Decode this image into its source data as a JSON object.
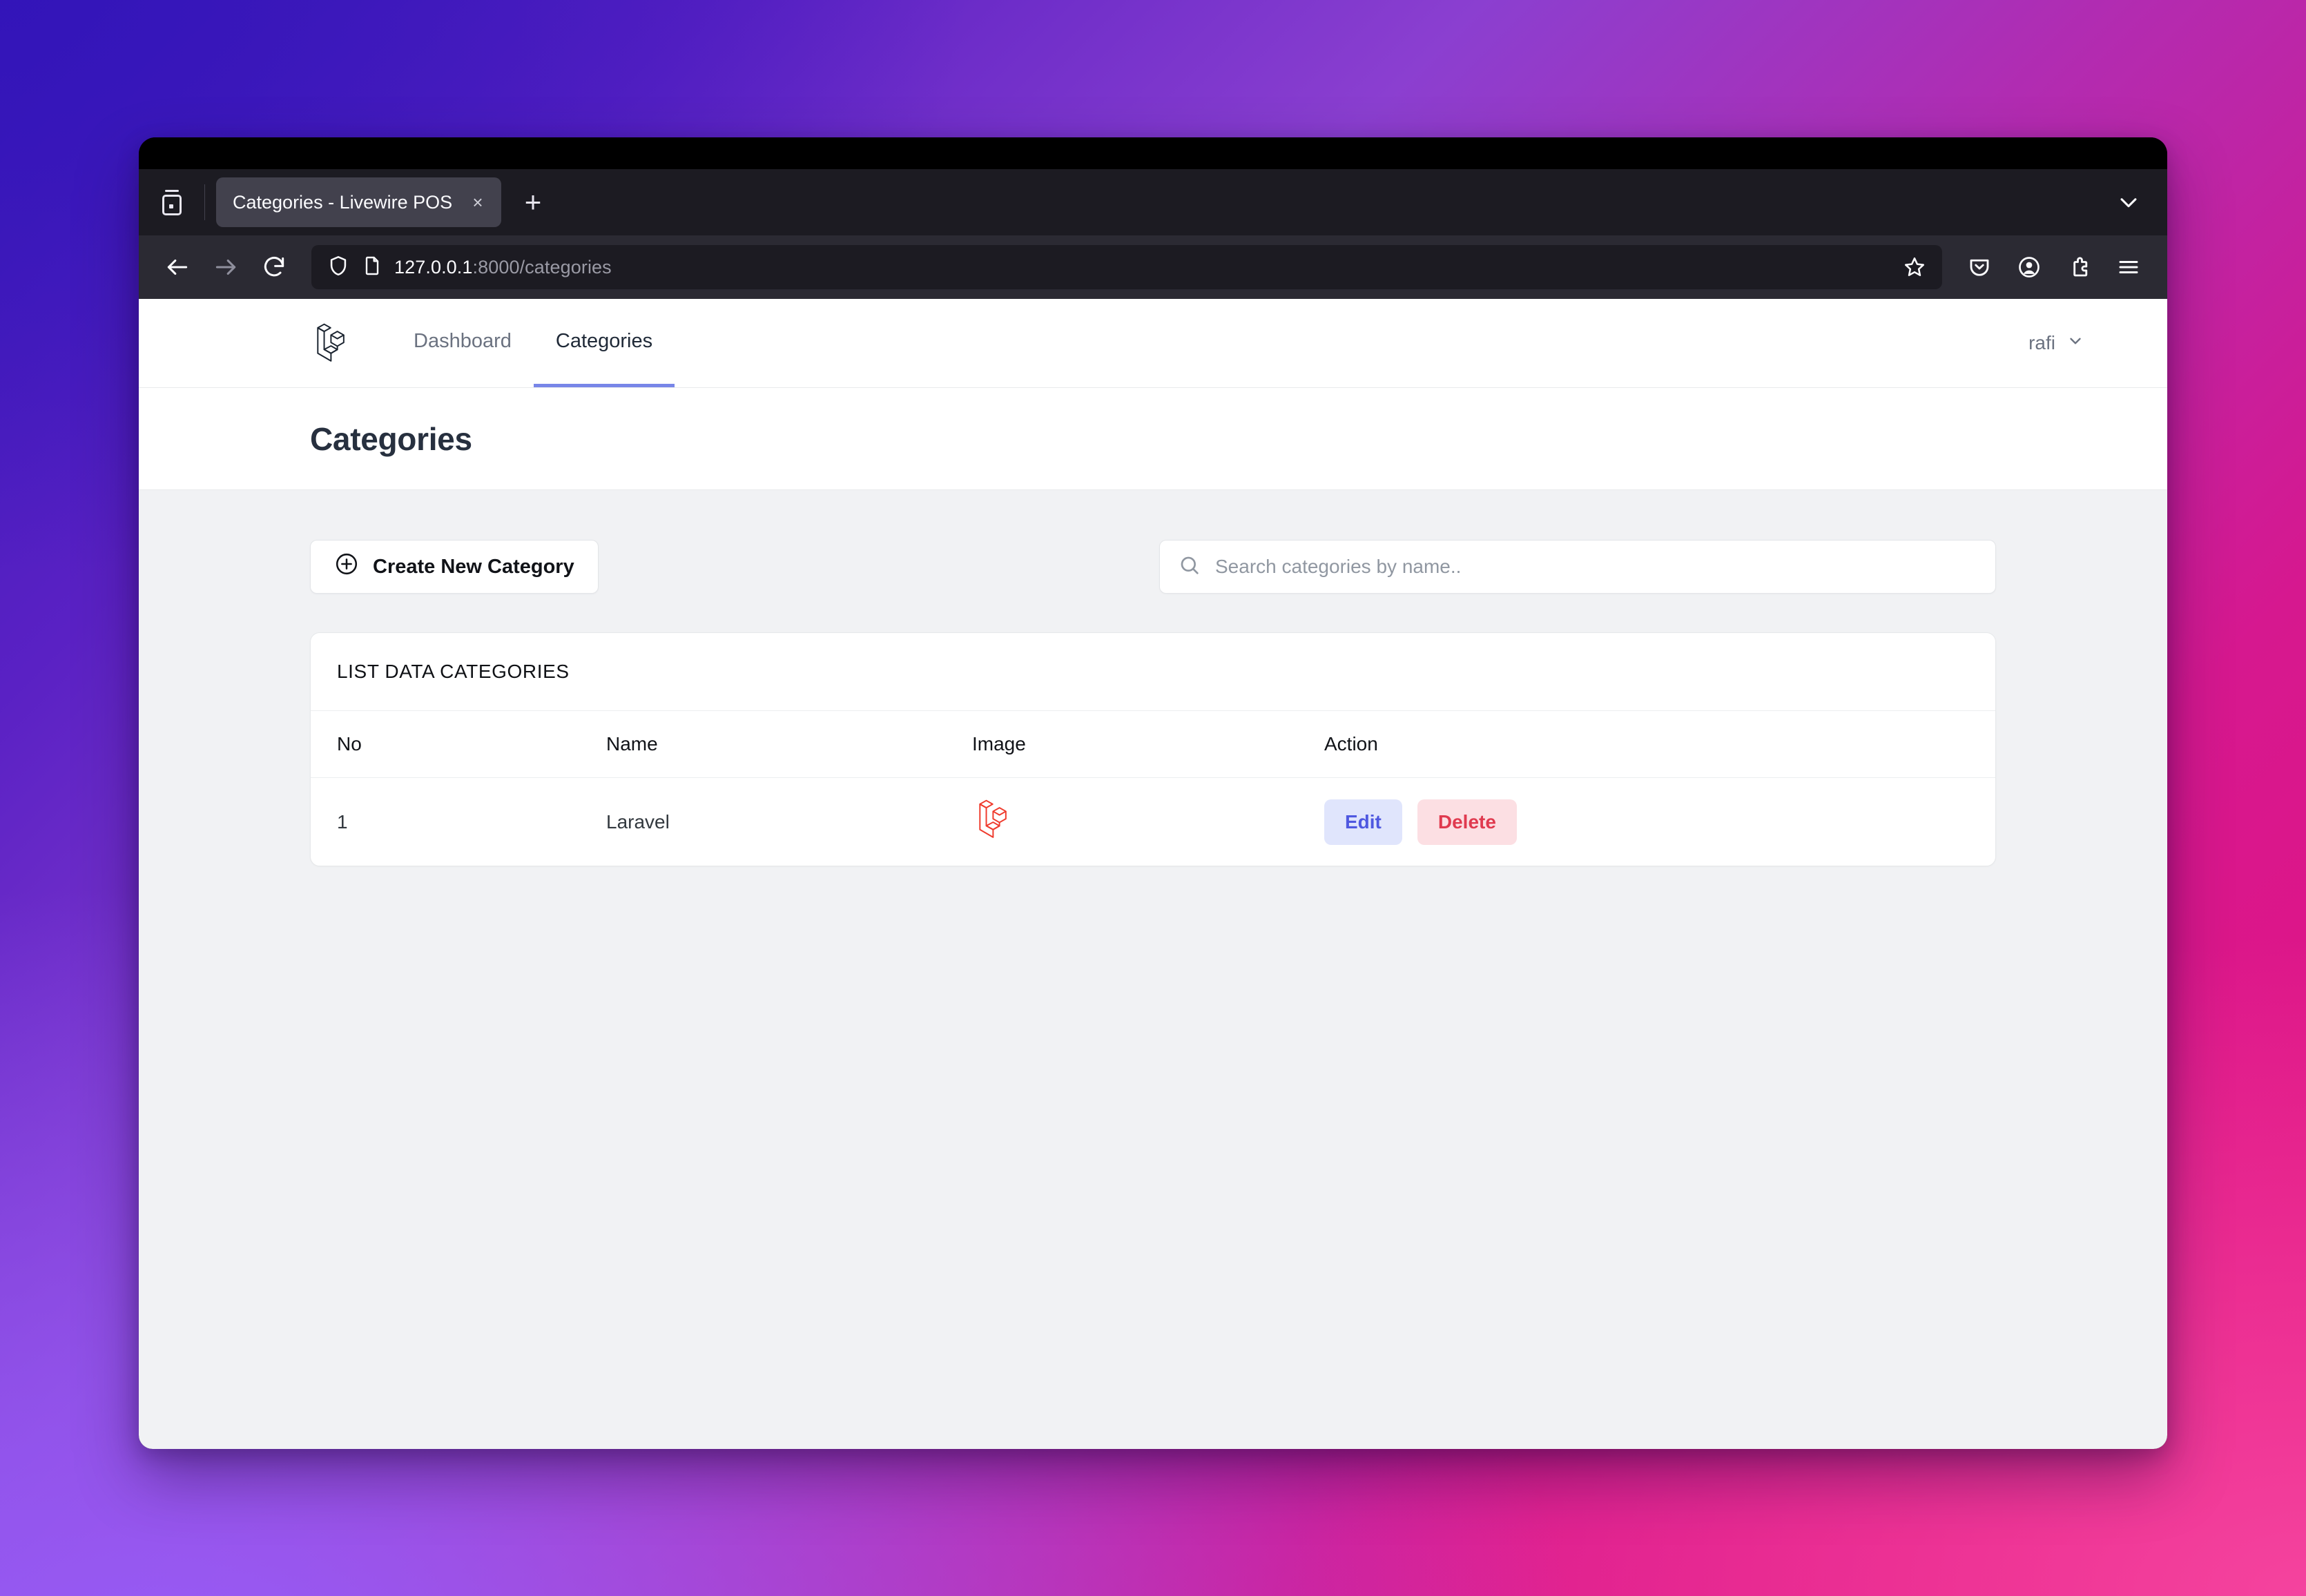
{
  "browser": {
    "firefox_view_tooltip": "Firefox View",
    "tab": {
      "title": "Categories - Livewire POS",
      "close_label": "×"
    },
    "new_tab_label": "+",
    "url": {
      "host": "127.0.0.1",
      "rest": ":8000/categories"
    },
    "icons": {
      "back": "back-arrow-icon",
      "forward": "forward-arrow-icon",
      "reload": "reload-icon",
      "shield": "shield-icon",
      "page": "page-document-icon",
      "bookmark": "star-icon",
      "pocket": "pocket-save-icon",
      "account": "account-icon",
      "extensions": "extensions-puzzle-icon",
      "menu": "hamburger-menu-icon",
      "tab_list": "chevron-down-icon"
    }
  },
  "app": {
    "brand": "laravel-logo",
    "nav": [
      {
        "label": "Dashboard",
        "active": false
      },
      {
        "label": "Categories",
        "active": true
      }
    ],
    "user": {
      "name": "rafi",
      "chevron": "chevron-down-icon"
    },
    "page_title": "Categories",
    "toolbar": {
      "create_label": "Create New Category",
      "create_icon": "plus-circle-icon",
      "search_icon": "search-icon",
      "search_placeholder": "Search categories by name..",
      "search_value": ""
    },
    "table": {
      "card_title": "LIST DATA CATEGORIES",
      "columns": [
        "No",
        "Name",
        "Image",
        "Action"
      ],
      "rows": [
        {
          "no": "1",
          "name": "Laravel",
          "image": "laravel-logo-red",
          "edit_label": "Edit",
          "delete_label": "Delete"
        }
      ]
    }
  },
  "colors": {
    "accent_indigo": "#7886e8",
    "edit_bg": "#e0e5fc",
    "edit_fg": "#4f58e0",
    "delete_bg": "#fcdfe3",
    "delete_fg": "#e03a4f",
    "laravel_red": "#ef3b2d",
    "page_bg": "#f1f2f4"
  }
}
